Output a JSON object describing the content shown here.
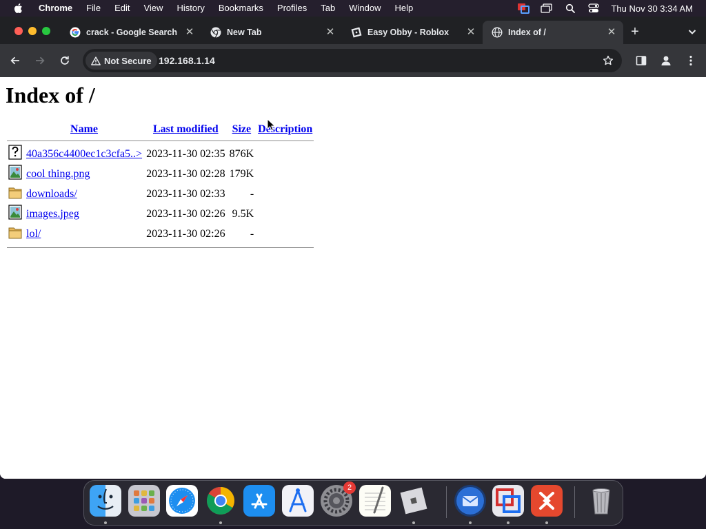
{
  "menubar": {
    "items": [
      "Chrome",
      "File",
      "Edit",
      "View",
      "History",
      "Bookmarks",
      "Profiles",
      "Tab",
      "Window",
      "Help"
    ],
    "clock": "Thu Nov 30  3:34 AM"
  },
  "tabs": [
    {
      "title": "crack - Google Search",
      "icon": "google-icon",
      "active": false
    },
    {
      "title": "New Tab",
      "icon": "chrome-icon",
      "active": false
    },
    {
      "title": "Easy Obby - Roblox",
      "icon": "roblox-icon",
      "active": false
    },
    {
      "title": "Index of /",
      "icon": "globe-icon",
      "active": true
    }
  ],
  "toolbar": {
    "security_label": "Not Secure",
    "url": "192.168.1.14"
  },
  "page": {
    "heading": "Index of /",
    "columns": {
      "name": "Name",
      "last_modified": "Last modified",
      "size": "Size",
      "description": "Description"
    },
    "rows": [
      {
        "icon": "unknown-file-icon",
        "name": "40a356c4400ec1c3cfa5..>",
        "modified": "2023-11-30 02:35",
        "size": "876K"
      },
      {
        "icon": "image-file-icon",
        "name": "cool thing.png",
        "modified": "2023-11-30 02:28",
        "size": "179K"
      },
      {
        "icon": "folder-icon",
        "name": "downloads/",
        "modified": "2023-11-30 02:33",
        "size": "-"
      },
      {
        "icon": "image-file-icon",
        "name": "images.jpeg",
        "modified": "2023-11-30 02:26",
        "size": "9.5K"
      },
      {
        "icon": "folder-icon",
        "name": "lol/",
        "modified": "2023-11-30 02:26",
        "size": "-"
      }
    ]
  },
  "dock": {
    "apps": [
      "Finder",
      "Launchpad",
      "Safari",
      "Chrome",
      "App Store",
      "Xcode Instruments",
      "System Settings",
      "TextEdit",
      "Roblox",
      "Thunderbird",
      "Parallels",
      "Remote Desktop",
      "Trash"
    ],
    "settings_badge": "2"
  },
  "colors": {
    "link": "#0000ee",
    "tabstrip": "#202124",
    "toolbar": "#35363a"
  }
}
